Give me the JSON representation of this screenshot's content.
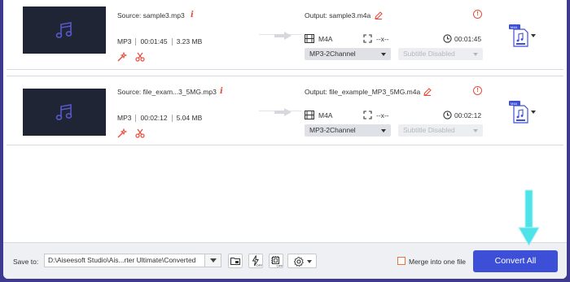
{
  "files": [
    {
      "source_label": "Source: sample3.mp3",
      "format": "MP3",
      "duration": "00:01:45",
      "size": "3.23 MB",
      "output_label": "Output: sample3.m4a",
      "out_format": "M4A",
      "resolution": "--x--",
      "out_duration": "00:01:45",
      "audio_track": "MP3-2Channel",
      "subtitle": "Subtitle Disabled"
    },
    {
      "source_label": "Source: file_exam...3_5MG.mp3",
      "format": "MP3",
      "duration": "00:02:12",
      "size": "5.04 MB",
      "output_label": "Output: file_example_MP3_5MG.m4a",
      "out_format": "M4A",
      "resolution": "--x--",
      "out_duration": "00:02:12",
      "audio_track": "MP3-2Channel",
      "subtitle": "Subtitle Disabled"
    }
  ],
  "bottom_bar": {
    "save_to_label": "Save to:",
    "save_path": "D:\\Aiseesoft Studio\\Ais...rter Ultimate\\Converted",
    "merge_label": "Merge into one file",
    "merge_checked": false,
    "convert_label": "Convert All"
  },
  "icons": {
    "thumbnail": "music-note-icon",
    "info": "info-icon",
    "edit": "magic-wand-icon",
    "cut": "scissors-icon",
    "arrow": "right-arrow-icon",
    "rename": "pencil-icon",
    "warning": "alert-circle-icon",
    "format": "film-icon",
    "resolution": "resize-icon",
    "duration": "clock-icon",
    "output_format": "m4a-file-icon",
    "folder": "folder-icon",
    "hw_accel": "lightning-off-icon",
    "gpu": "chip-off-icon",
    "settings": "gear-icon",
    "pointer": "cyan-down-arrow-icon"
  },
  "colors": {
    "accent": "#3d4fd6",
    "frame": "#3d3a8f",
    "warning": "#e84c3d",
    "pointer": "#4de3e8"
  }
}
